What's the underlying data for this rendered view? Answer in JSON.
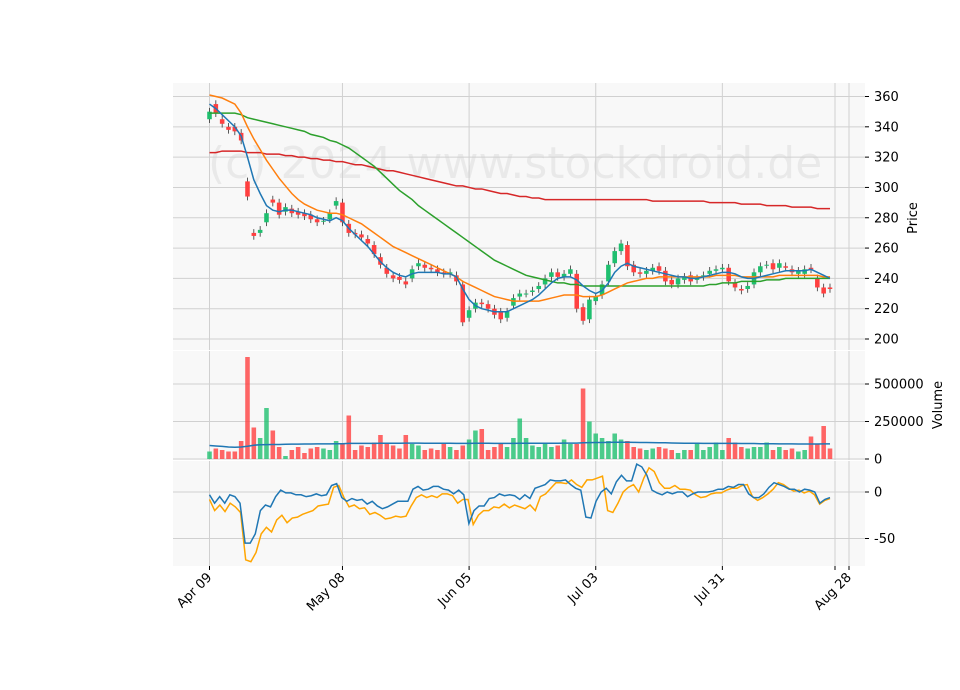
{
  "watermark": "(c) 2024 www.stockdroid.de",
  "colors": {
    "up": "#1fbf6f",
    "down": "#ff4040",
    "panel_bg": "#f8f8f8",
    "grid": "#d0d0d0",
    "ma_blue": "#1f77b4",
    "ma_orange": "#ff7f0e",
    "ma_green": "#2ca02c",
    "ma_red": "#d62728",
    "osc_orange": "#ffa500"
  },
  "chart_data": [
    {
      "type": "candlestick",
      "ylabel": "Price",
      "ylim": [
        193,
        367
      ],
      "yticks": [
        200,
        220,
        240,
        260,
        280,
        300,
        320,
        340,
        360
      ],
      "x_tick_labels": [
        "Apr 09",
        "May 08",
        "Jun 05",
        "Jul 03",
        "Jul 31",
        "Aug 28"
      ],
      "x_tick_index": [
        0,
        21,
        41,
        61,
        81,
        101
      ],
      "grid": true,
      "close": [
        350,
        349,
        342,
        338,
        337,
        331,
        294,
        268,
        272,
        283,
        290,
        282,
        287,
        283,
        282,
        281,
        279,
        277,
        278,
        283,
        291,
        277,
        270,
        269,
        267,
        263,
        256,
        249,
        243,
        240,
        239,
        236,
        246,
        250,
        247,
        246,
        244,
        243,
        244,
        238,
        211,
        219,
        224,
        223,
        220,
        216,
        213,
        218,
        227,
        230,
        230,
        232,
        235,
        240,
        244,
        241,
        243,
        246,
        220,
        212,
        226,
        228,
        236,
        249,
        258,
        263,
        248,
        244,
        243,
        245,
        247,
        245,
        238,
        236,
        240,
        241,
        238,
        240,
        242,
        245,
        246,
        247,
        238,
        234,
        232,
        235,
        244,
        248,
        249,
        246,
        250,
        247,
        244,
        245,
        246,
        246,
        234,
        230,
        233
      ],
      "open": [
        345,
        355,
        345,
        340,
        340,
        336,
        304,
        270,
        270,
        277,
        292,
        290,
        284,
        286,
        284,
        283,
        282,
        279,
        278,
        279,
        288,
        290,
        276,
        270,
        269,
        266,
        262,
        254,
        247,
        242,
        241,
        238,
        240,
        248,
        249,
        247,
        246,
        244,
        243,
        242,
        236,
        214,
        220,
        224,
        223,
        220,
        218,
        214,
        222,
        228,
        230,
        231,
        233,
        236,
        241,
        244,
        241,
        243,
        243,
        221,
        213,
        225,
        229,
        238,
        250,
        258,
        262,
        249,
        244,
        243,
        245,
        248,
        245,
        239,
        236,
        239,
        242,
        239,
        241,
        243,
        245,
        246,
        247,
        237,
        233,
        233,
        236,
        244,
        249,
        250,
        247,
        248,
        246,
        243,
        243,
        247,
        240,
        234,
        234
      ],
      "ma_blue": [
        355,
        352,
        348,
        344,
        340,
        334,
        320,
        305,
        296,
        288,
        285,
        284,
        285,
        285,
        284,
        283,
        282,
        280,
        279,
        278,
        280,
        278,
        273,
        269,
        265,
        261,
        256,
        251,
        247,
        244,
        242,
        241,
        243,
        244,
        244,
        244,
        244,
        243,
        243,
        241,
        233,
        226,
        222,
        220,
        219,
        218,
        218,
        218,
        220,
        222,
        224,
        226,
        229,
        233,
        237,
        240,
        241,
        241,
        239,
        235,
        232,
        230,
        232,
        237,
        244,
        248,
        250,
        248,
        247,
        246,
        245,
        244,
        243,
        242,
        241,
        241,
        240,
        240,
        241,
        242,
        243,
        244,
        244,
        243,
        241,
        240,
        240,
        241,
        242,
        243,
        244,
        245,
        245,
        245,
        245,
        246,
        244,
        242,
        240
      ],
      "ma_orange": [
        361,
        360,
        359,
        357,
        355,
        349,
        340,
        332,
        325,
        318,
        312,
        306,
        301,
        296,
        292,
        289,
        287,
        285,
        284,
        283,
        283,
        282,
        280,
        278,
        276,
        273,
        270,
        267,
        264,
        261,
        259,
        257,
        255,
        253,
        251,
        249,
        247,
        245,
        243,
        241,
        238,
        236,
        234,
        232,
        230,
        228,
        227,
        226,
        225,
        225,
        225,
        225,
        225,
        226,
        227,
        228,
        229,
        229,
        229,
        228,
        228,
        228,
        229,
        231,
        233,
        235,
        237,
        238,
        239,
        240,
        240,
        241,
        241,
        241,
        241,
        241,
        241,
        241,
        241,
        241,
        242,
        242,
        242,
        242,
        241,
        241,
        241,
        241,
        241,
        241,
        242,
        242,
        242,
        242,
        242,
        242,
        242,
        241,
        241
      ],
      "ma_green": [
        349,
        349,
        349,
        349,
        349,
        348,
        346,
        345,
        344,
        343,
        342,
        341,
        340,
        339,
        338,
        337,
        335,
        334,
        333,
        331,
        330,
        328,
        326,
        323,
        320,
        317,
        314,
        310,
        306,
        302,
        298,
        295,
        292,
        288,
        285,
        282,
        279,
        276,
        273,
        270,
        267,
        264,
        261,
        258,
        255,
        252,
        250,
        248,
        246,
        244,
        242,
        241,
        240,
        239,
        238,
        237,
        237,
        236,
        236,
        235,
        235,
        235,
        235,
        235,
        235,
        235,
        235,
        235,
        235,
        235,
        235,
        235,
        235,
        235,
        235,
        235,
        235,
        235,
        235,
        236,
        236,
        237,
        237,
        237,
        238,
        238,
        238,
        238,
        239,
        239,
        239,
        240,
        240,
        240,
        240,
        240,
        240,
        240,
        240
      ],
      "ma_red": [
        323,
        323,
        324,
        324,
        324,
        324,
        323,
        323,
        323,
        322,
        322,
        322,
        321,
        321,
        320,
        320,
        319,
        319,
        318,
        318,
        317,
        317,
        316,
        315,
        315,
        314,
        313,
        312,
        311,
        311,
        310,
        309,
        308,
        307,
        306,
        305,
        304,
        303,
        302,
        301,
        301,
        300,
        299,
        299,
        298,
        297,
        296,
        296,
        295,
        294,
        294,
        293,
        293,
        292,
        292,
        292,
        292,
        292,
        292,
        292,
        292,
        292,
        292,
        292,
        292,
        292,
        292,
        292,
        292,
        292,
        291,
        291,
        291,
        291,
        291,
        291,
        291,
        291,
        291,
        290,
        290,
        290,
        290,
        290,
        289,
        289,
        289,
        289,
        288,
        288,
        288,
        288,
        287,
        287,
        287,
        287,
        286,
        286,
        286
      ]
    },
    {
      "type": "bar",
      "ylabel": "Volume",
      "ylim": [
        0,
        680000
      ],
      "yticks": [
        0,
        250000,
        500000
      ],
      "values": [
        50000,
        70000,
        60000,
        50000,
        50000,
        120000,
        680000,
        210000,
        140000,
        340000,
        190000,
        80000,
        20000,
        60000,
        80000,
        40000,
        70000,
        80000,
        70000,
        60000,
        120000,
        100000,
        290000,
        60000,
        90000,
        80000,
        110000,
        160000,
        100000,
        90000,
        70000,
        160000,
        100000,
        90000,
        60000,
        70000,
        60000,
        110000,
        80000,
        60000,
        90000,
        130000,
        190000,
        200000,
        60000,
        80000,
        100000,
        80000,
        140000,
        270000,
        140000,
        90000,
        80000,
        100000,
        80000,
        90000,
        130000,
        100000,
        100000,
        470000,
        250000,
        170000,
        140000,
        120000,
        170000,
        130000,
        120000,
        80000,
        70000,
        60000,
        70000,
        80000,
        70000,
        60000,
        40000,
        60000,
        60000,
        110000,
        60000,
        80000,
        110000,
        60000,
        140000,
        110000,
        80000,
        70000,
        80000,
        80000,
        110000,
        60000,
        80000,
        60000,
        70000,
        50000,
        60000,
        150000,
        100000,
        220000,
        70000
      ],
      "ma": [
        90000,
        87000,
        84000,
        80000,
        78000,
        80000,
        85000,
        92000,
        95000,
        96000,
        97000,
        97000,
        98000,
        99000,
        99000,
        100000,
        100000,
        101000,
        101000,
        101000,
        102000,
        102000,
        104000,
        104000,
        104000,
        104000,
        104000,
        105000,
        105000,
        105000,
        105000,
        106000,
        106000,
        106000,
        105000,
        105000,
        105000,
        105000,
        105000,
        104000,
        104000,
        104000,
        105000,
        105000,
        105000,
        104000,
        104000,
        104000,
        104000,
        105000,
        105000,
        105000,
        105000,
        105000,
        105000,
        105000,
        106000,
        106000,
        106000,
        108000,
        109000,
        110000,
        110000,
        111000,
        112000,
        112000,
        112000,
        111000,
        110000,
        110000,
        109000,
        108000,
        108000,
        107000,
        106000,
        105000,
        105000,
        105000,
        104000,
        104000,
        104000,
        104000,
        104000,
        104000,
        103000,
        103000,
        103000,
        102000,
        102000,
        102000,
        101000,
        101000,
        101000,
        100000,
        100000,
        100000,
        100000,
        101000,
        101000
      ]
    },
    {
      "type": "line",
      "ylim": [
        -82,
        22
      ],
      "yticks": [
        -50,
        0
      ],
      "series_blue": [
        -3,
        -12,
        -5,
        -12,
        -3,
        -5,
        -12,
        -55,
        -55,
        -45,
        -20,
        -14,
        -16,
        -5,
        2,
        -1,
        -1,
        -3,
        -3,
        -5,
        -4,
        -2,
        -4,
        -3,
        7,
        9,
        -6,
        -10,
        -7,
        -9,
        -8,
        -13,
        -10,
        -15,
        -18,
        -16,
        -13,
        -10,
        -10,
        -10,
        3,
        6,
        2,
        3,
        6,
        6,
        3,
        2,
        -2,
        2,
        -3,
        -34,
        -20,
        -15,
        -15,
        -7,
        -6,
        -2,
        -4,
        -3,
        -4,
        -8,
        -3,
        -7,
        4,
        6,
        8,
        13,
        12,
        12,
        13,
        8,
        4,
        2,
        -27,
        -28,
        -10,
        0,
        4,
        -2,
        11,
        18,
        12,
        12,
        30,
        27,
        18,
        2,
        -1,
        -3,
        0,
        -2,
        0,
        0,
        -5,
        -2,
        0,
        0,
        0,
        1,
        3,
        3,
        6,
        5,
        8,
        8,
        -2,
        -6,
        -6,
        -2,
        5,
        10,
        8,
        6,
        3,
        3,
        0,
        3,
        2,
        0,
        -12,
        -8,
        -6
      ],
      "series_orange": [
        -8,
        -20,
        -14,
        -21,
        -12,
        -16,
        -22,
        -73,
        -75,
        -65,
        -45,
        -38,
        -43,
        -30,
        -25,
        -33,
        -28,
        -27,
        -24,
        -22,
        -20,
        -15,
        -14,
        -13,
        5,
        7,
        -6,
        -16,
        -14,
        -18,
        -17,
        -24,
        -22,
        -25,
        -29,
        -28,
        -26,
        -27,
        -26,
        -15,
        -6,
        -3,
        -6,
        -4,
        -6,
        -2,
        -2,
        -4,
        -12,
        -8,
        -8,
        -35,
        -25,
        -20,
        -20,
        -16,
        -17,
        -13,
        -17,
        -14,
        -16,
        -18,
        -14,
        -20,
        -5,
        -2,
        4,
        10,
        10,
        9,
        13,
        8,
        5,
        13,
        13,
        15,
        17,
        -20,
        -22,
        -12,
        0,
        5,
        8,
        0,
        15,
        26,
        22,
        10,
        4,
        4,
        7,
        3,
        3,
        2,
        -3,
        -6,
        -5,
        -2,
        -1,
        -1,
        2,
        4,
        4,
        7,
        8,
        -5,
        -9,
        -6,
        -2,
        3,
        10,
        8,
        4,
        1,
        2,
        -1,
        1,
        -3,
        -13,
        -9,
        -7
      ]
    }
  ]
}
